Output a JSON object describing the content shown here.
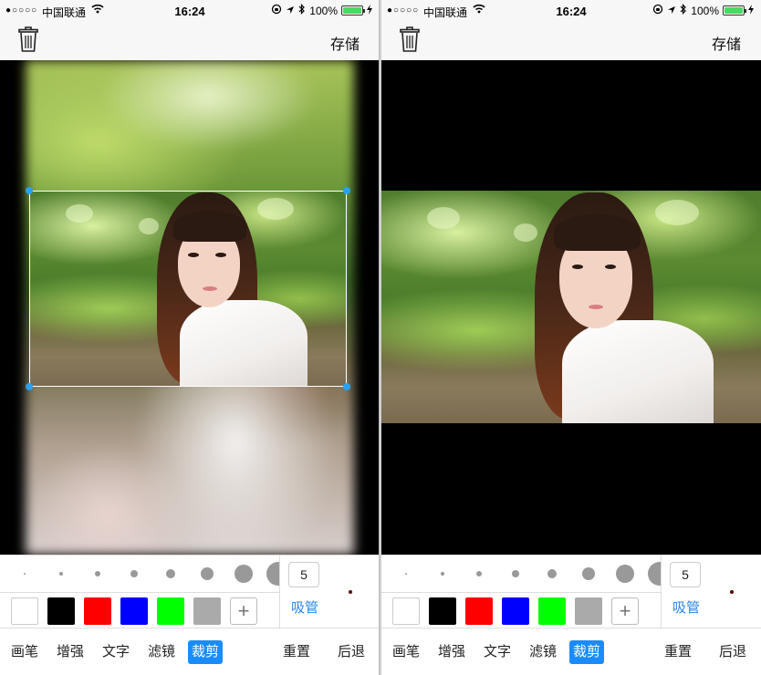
{
  "status_bar": {
    "signal": "●○○○○",
    "carrier": "中国联通",
    "time": "16:24",
    "battery": "100%"
  },
  "navbar": {
    "save_label": "存储"
  },
  "tools": {
    "brush_sizes": [
      2,
      4,
      6,
      8,
      10,
      14,
      20,
      26
    ],
    "size_value": "5",
    "picker_label": "吸管",
    "swatch_colors": [
      "#ffffff",
      "#000000",
      "#ff0000",
      "#0000ff",
      "#00ff00",
      "#aaaaaa"
    ],
    "add_label": "+"
  },
  "bottom_bar": {
    "tabs": [
      "画笔",
      "增强",
      "文字",
      "滤镜",
      "裁剪"
    ],
    "active_tab": "裁剪",
    "reset_label": "重置",
    "undo_label": "后退"
  },
  "colors": {
    "accent": "#1a8cff",
    "handle": "#2aa0f0",
    "picker": "#2a86e8"
  }
}
